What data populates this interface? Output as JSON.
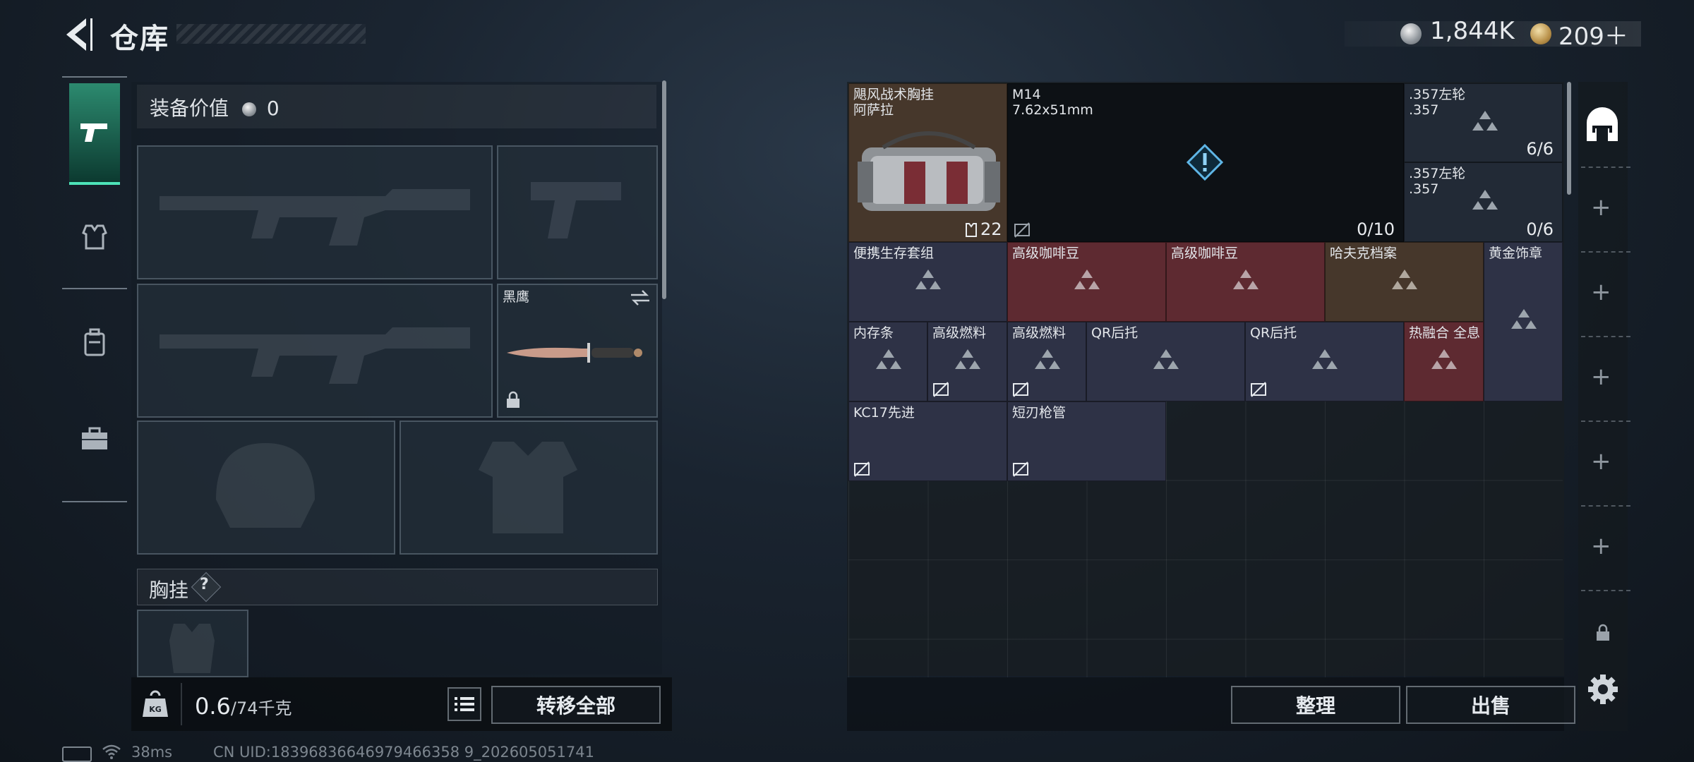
{
  "header": {
    "title": "仓库",
    "currency_silver": "1,844K",
    "currency_gold": "209＋"
  },
  "left": {
    "equip_value_label": "装备价值",
    "equip_value": "0",
    "knife_name": "黑鹰",
    "section_label": "胸挂",
    "section_help": "?",
    "weight_value": "0.6",
    "weight_max": "/74千克",
    "transfer_all": "转移全部"
  },
  "grid": {
    "items": [
      {
        "name": "飓风战术胸挂\n阿萨拉",
        "count": "22"
      },
      {
        "name": "M14\n7.62x51mm",
        "count": "0/10"
      },
      {
        "name": ".357左轮\n.357",
        "count": "6/6"
      },
      {
        "name": ".357左轮\n.357",
        "count": "0/6"
      },
      {
        "name": "便携生存套组"
      },
      {
        "name": "高级咖啡豆"
      },
      {
        "name": "高级咖啡豆"
      },
      {
        "name": "哈夫克档案"
      },
      {
        "name": "黄金饰章"
      },
      {
        "name": "内存条"
      },
      {
        "name": "高级燃料"
      },
      {
        "name": "高级燃料"
      },
      {
        "name": "QR后托"
      },
      {
        "name": "QR后托"
      },
      {
        "name": "热融合 全息"
      },
      {
        "name": "KC17先进"
      },
      {
        "name": "短刃枪管"
      }
    ]
  },
  "right": {
    "sort": "整理",
    "sell": "出售"
  },
  "status": {
    "ping": "38ms",
    "uid": "CN UID:18396836646979466358 9_202605051741"
  },
  "colors": {
    "accent": "#4de3b8",
    "red_item": "#5e2a31",
    "purple_item": "#2e3246",
    "brown_item": "#46372b"
  }
}
